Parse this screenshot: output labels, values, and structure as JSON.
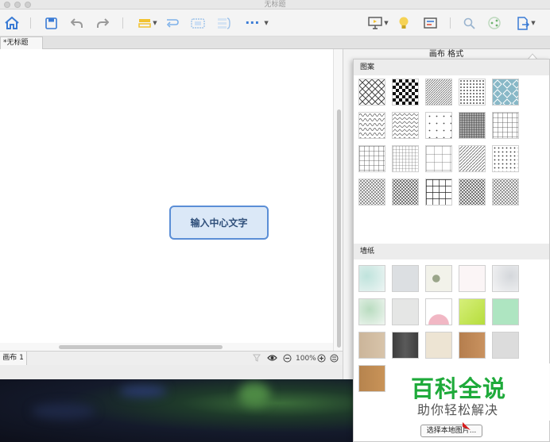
{
  "window": {
    "title": "无标题"
  },
  "toolbar": {
    "icons": [
      "home-icon",
      "save-icon",
      "undo-icon",
      "redo-icon",
      "style-icon",
      "relationship-icon",
      "boundary-icon",
      "summary-icon",
      "more-icon",
      "presentation-icon",
      "idea-icon",
      "outline-icon",
      "search-icon",
      "share-icon",
      "export-icon"
    ],
    "more_label": "···"
  },
  "tabs": {
    "document_tab": "*无标题"
  },
  "canvas": {
    "central_topic": "输入中心文字"
  },
  "statusbar": {
    "sheet_tab": "画布 1",
    "zoom": "100%"
  },
  "right_panel": {
    "title": "画布 格式"
  },
  "popup": {
    "pattern_section": "图案",
    "wallpaper_section": "墙纸",
    "choose_local_image": "选择本地图片..."
  },
  "watermark": {
    "title": "百科全说",
    "subtitle": "助你轻松解决"
  },
  "colors": {
    "accent": "#5b8ed6",
    "watermark_green": "#1eaa3a"
  }
}
